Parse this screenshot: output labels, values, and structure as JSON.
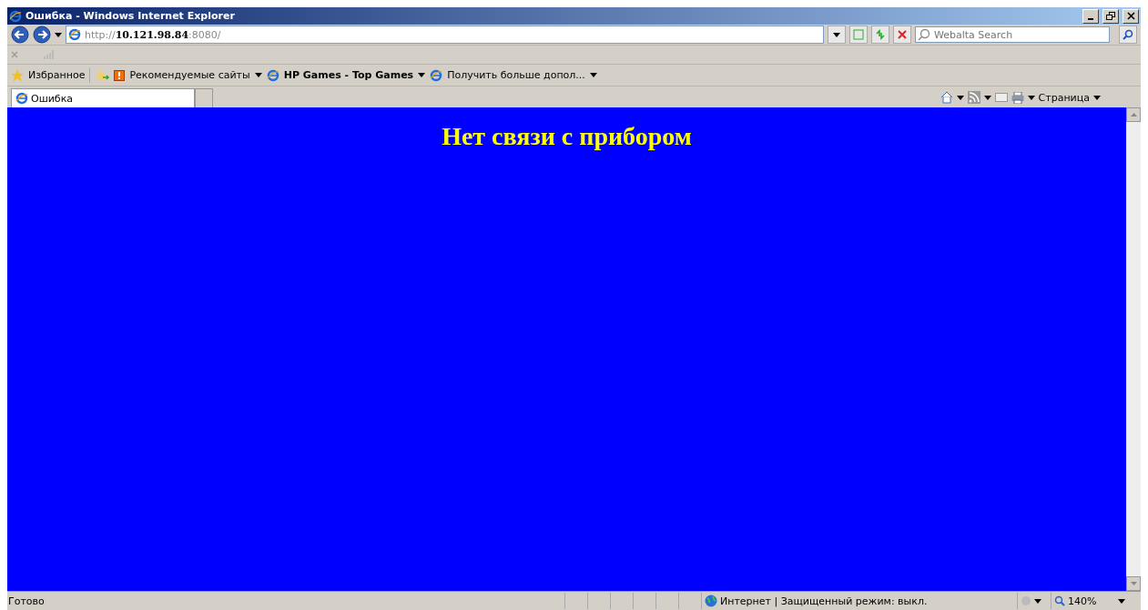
{
  "window": {
    "title": "Ошибка - Windows Internet Explorer"
  },
  "address": {
    "scheme": "http://",
    "host": "10.121.98.84",
    "port": ":8080/"
  },
  "search": {
    "placeholder": "Webalta Search"
  },
  "favorites_bar": {
    "favorites": "Избранное",
    "links": [
      {
        "label": "Рекомендуемые сайты",
        "bold": false,
        "kind": "suggested"
      },
      {
        "label": "HP Games - Top Games",
        "bold": true,
        "kind": "page"
      },
      {
        "label": "Получить больше допол...",
        "bold": false,
        "kind": "page"
      }
    ]
  },
  "tabs": [
    {
      "label": "Ошибка",
      "selected": true
    }
  ],
  "command_bar": {
    "page_menu": "Страница"
  },
  "page": {
    "heading": "Нет связи с прибором"
  },
  "status_bar": {
    "text": "Готово",
    "zone": "Интернет | Защищенный режим: выкл.",
    "zoom": "140%"
  }
}
